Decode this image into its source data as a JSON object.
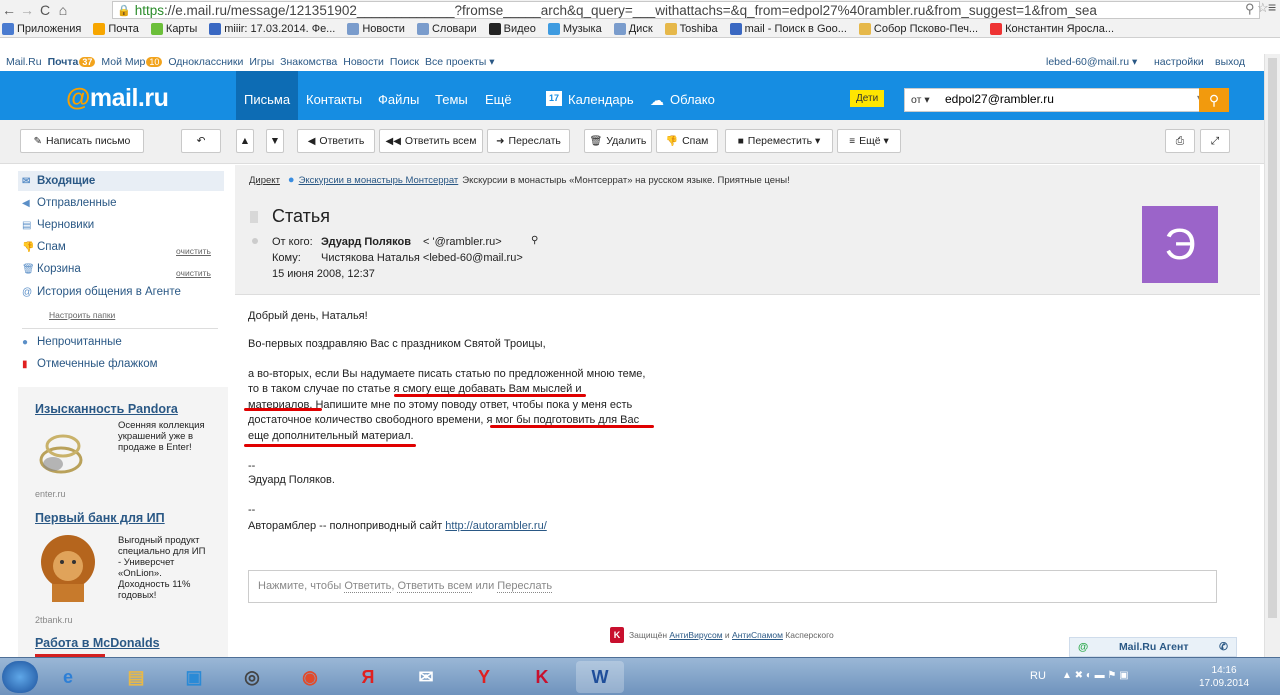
{
  "browser": {
    "url_prefix": "https",
    "url_rest": "://e.mail.ru/message/121351902_____________?fromse_____arch&q_query=___withattachs=&q_from=edpol27%40rambler.ru&from_suggest=1&from_sea",
    "bookmarks": [
      {
        "label": "Приложения",
        "color": "#4a7bd0"
      },
      {
        "label": "Почта",
        "color": "#f7a600"
      },
      {
        "label": "Карты",
        "color": "#6cbf3a"
      },
      {
        "label": "miiir: 17.03.2014. Фе...",
        "color": "#3a68c2"
      },
      {
        "label": "Новости",
        "color": "#7a9ccc"
      },
      {
        "label": "Словари",
        "color": "#7a9ccc"
      },
      {
        "label": "Видео",
        "color": "#222222"
      },
      {
        "label": "Музыка",
        "color": "#3e9be0"
      },
      {
        "label": "Диск",
        "color": "#7a9ccc"
      },
      {
        "label": "Toshiba",
        "color": "#e6b84a"
      },
      {
        "label": "mail - Поиск в Goo...",
        "color": "#3a68c2"
      },
      {
        "label": "Собор Псково-Печ...",
        "color": "#e6b84a"
      },
      {
        "label": "Константин Яросла...",
        "color": "#e33"
      }
    ]
  },
  "portal": {
    "left": [
      "Mail.Ru",
      "Почта",
      "Мой Мир",
      "Одноклассники",
      "Игры",
      "Знакомства",
      "Новости",
      "Поиск",
      "Все проекты ▾"
    ],
    "pochta_count": "37",
    "mymir_count": "10",
    "user": "lebed-60@mail.ru ▾",
    "settings": "настройки",
    "exit": "выход"
  },
  "header": {
    "logo_at": "@",
    "logo_rest": "mail.ru",
    "nav": [
      "Письма",
      "Контакты",
      "Файлы",
      "Темы",
      "Ещё"
    ],
    "calendar": "Календарь",
    "calendar_day": "17",
    "cloud": "Облако",
    "kids": "Дети",
    "search_from": "от ▾",
    "search_value": "edpol27@rambler.ru"
  },
  "toolbar": {
    "compose": "Написать письмо",
    "reply": "Ответить",
    "reply_all": "Ответить всем",
    "forward": "Переслать",
    "delete": "Удалить",
    "spam": "Спам",
    "move": "Переместить ▾",
    "more": "Ещё ▾"
  },
  "sidebar": {
    "folders": [
      {
        "label": "Входящие"
      },
      {
        "label": "Отправленные"
      },
      {
        "label": "Черновики"
      },
      {
        "label": "Спам"
      },
      {
        "label": "Корзина"
      },
      {
        "label": "История общения в Агенте"
      }
    ],
    "clear": "очистить",
    "setup_folders": "Настроить папки",
    "unread": "Непрочитанные",
    "flagged": "Отмеченные флажком",
    "ads": [
      {
        "title": "Изысканность Pandora",
        "text": [
          "Осенняя коллекция",
          "украшений уже в",
          "продаже в Enter!"
        ],
        "domain": "enter.ru"
      },
      {
        "title": "Первый банк для ИП",
        "text": [
          "Выгодный продукт",
          "специально для ИП",
          "- Универсчет",
          "«OnLion».",
          "Доходность 11%",
          "годовых!"
        ],
        "domain": "2tbank.ru"
      },
      {
        "title": "Работа в McDonalds"
      }
    ]
  },
  "direct": {
    "label": "Директ",
    "link": "Экскурсии в монастырь Монтсеррат",
    "text": "Экскурсии в монастырь «Монтсеррат» на русском языке. Приятные цены!"
  },
  "message": {
    "subject": "Статья",
    "from_label": "От кого:",
    "from_name": "Эдуард Поляков",
    "from_email": "<       '@rambler.ru>",
    "to_label": "Кому:",
    "to": "Чистякова Наталья <lebed-60@mail.ru>",
    "date": "15 июня 2008, 12:37",
    "avatar_letter": "Э",
    "avatar_color": "#9b64c9",
    "body": [
      "Добрый день, Наталья!",
      "Во-первых поздравляю Вас с праздником Святой Троицы,",
      "а во-вторых, если Вы надумаете писать статью по предложенной мною теме,",
      "то в таком случае по статье я смогу еще добавать Вам мыслей и",
      "материалов. Напишите мне по этому поводу ответ, чтобы пока у меня есть",
      "достаточное количество свободного времени, я мог бы подготовить для Вас",
      "еще дополнительный материал.",
      "--",
      "Эдуард Поляков.",
      "--"
    ],
    "sig_prefix": "Авторамблер -- полноприводный сайт",
    "sig_link": "http://autorambler.ru/"
  },
  "reply_box": {
    "prefix": "Нажмите, чтобы",
    "reply": "Ответить",
    "sep": ",",
    "reply_all": "Ответить всем",
    "or": "или",
    "forward": "Переслать"
  },
  "footer": {
    "text1": "Защищён",
    "link1": "АнтиВирусом",
    "and": "и",
    "link2": "АнтиСпамом",
    "text2": "Касперского"
  },
  "agent": {
    "label": "Mail.Ru Агент"
  },
  "taskbar": {
    "lang": "RU",
    "time": "14:16",
    "date": "17.09.2014"
  },
  "colors": {
    "header_blue": "#168de2",
    "accent_orange": "#f29a0d",
    "highlight_red": "#e00000"
  }
}
